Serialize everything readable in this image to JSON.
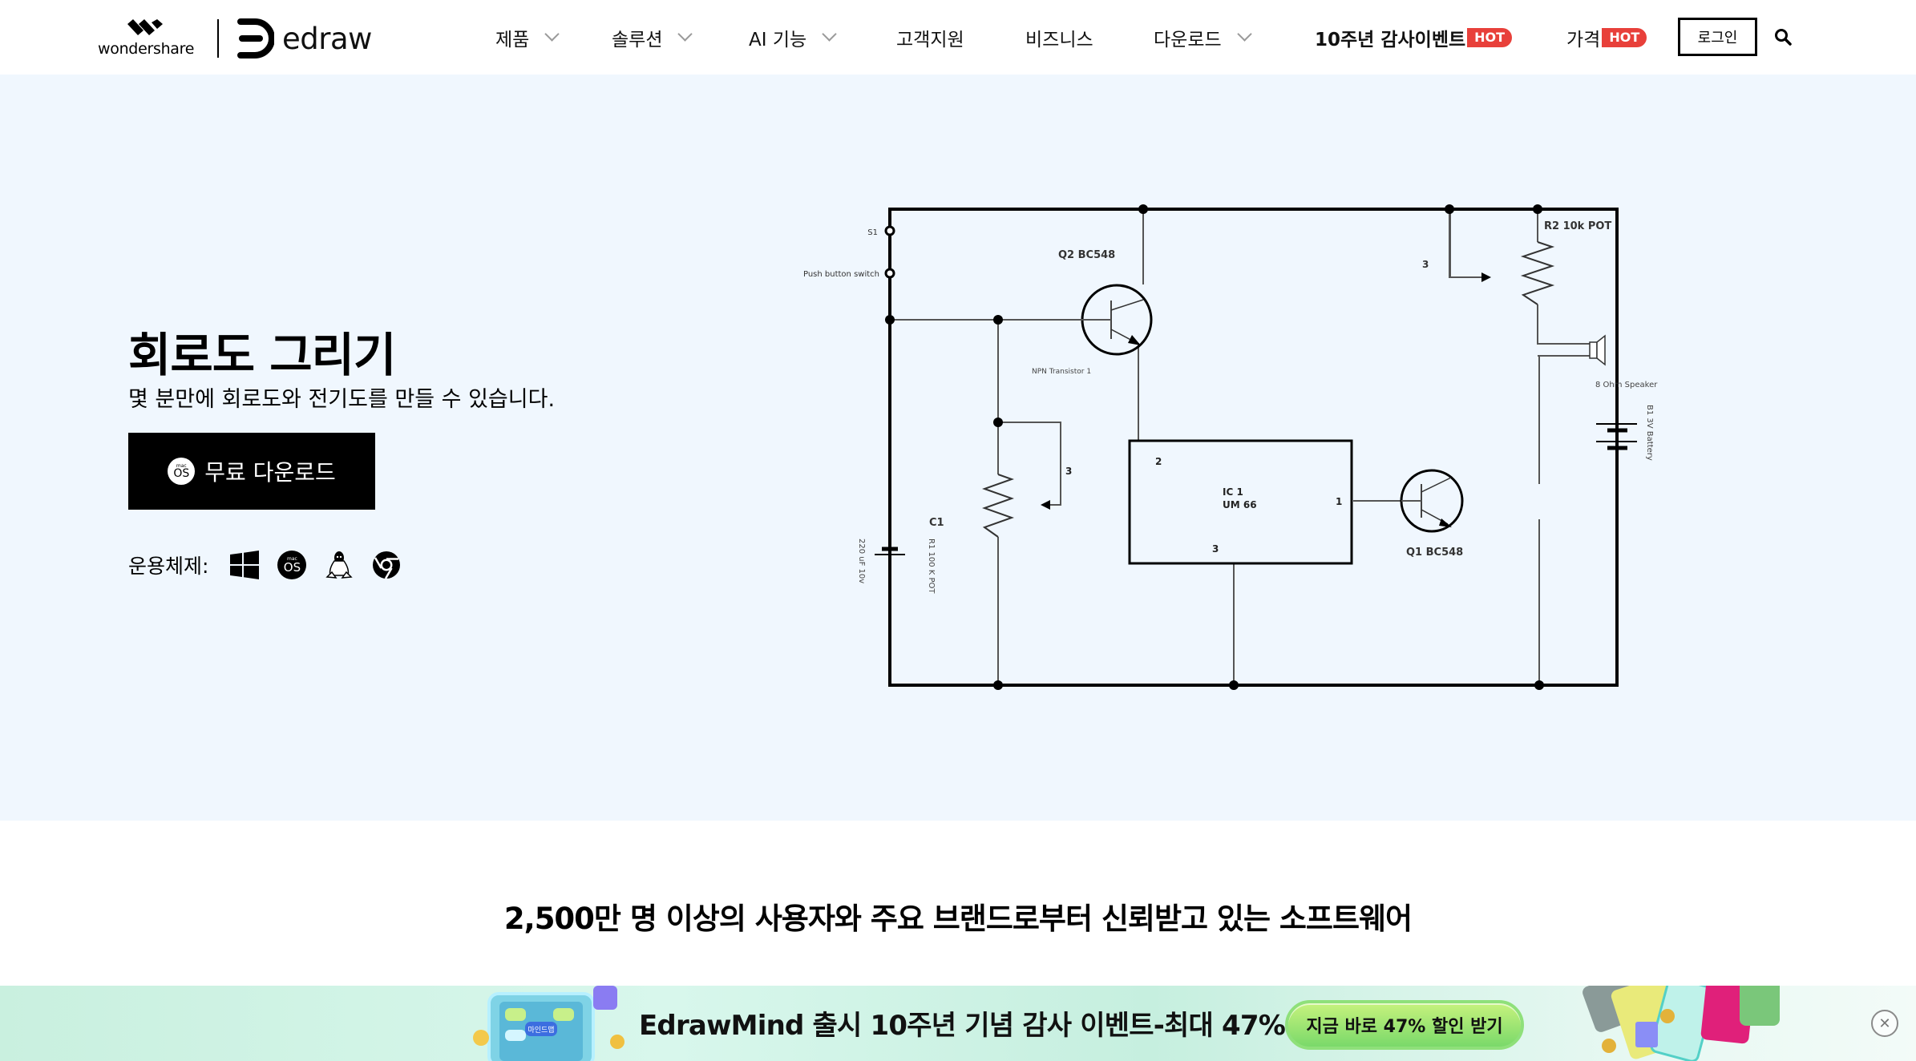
{
  "header": {
    "brand_parent": "wondershare",
    "brand_product": "edraw",
    "nav": [
      {
        "label": "제품",
        "has_dropdown": true
      },
      {
        "label": "솔루션",
        "has_dropdown": true
      },
      {
        "label": "AI 기능",
        "has_dropdown": true
      },
      {
        "label": "고객지원",
        "has_dropdown": false
      },
      {
        "label": "비즈니스",
        "has_dropdown": false
      },
      {
        "label": "다운로드",
        "has_dropdown": true
      },
      {
        "label": "10주년 감사이벤트",
        "badge": "HOT",
        "bold": true
      },
      {
        "label": "가격",
        "badge": "HOT"
      }
    ],
    "login_label": "로그인",
    "search_icon": "search-icon"
  },
  "hero": {
    "title": "회로도 그리기",
    "subtitle": "몇 분만에 회로도와 전기도를 만들 수 있습니다.",
    "download_button": {
      "label": "무료 다운로드",
      "badge_top": "mac",
      "badge_main": "OS"
    },
    "os_label": "운용체제:",
    "os_icons": [
      "windows-icon",
      "macos-icon",
      "linux-icon",
      "chrome-icon"
    ]
  },
  "circuit": {
    "labels": {
      "s1": "S1",
      "push_button": "Push button switch",
      "q2": "Q2 BC548",
      "npn": "NPN Transistor 1",
      "r2": "R2 10k POT",
      "pin3_top": "3",
      "speaker": "8 Ohm Speaker",
      "battery": "B1 3V Battery",
      "ic_pin2": "2",
      "ic_name": "IC 1",
      "ic_model": "UM 66",
      "ic_pin1": "1",
      "ic_pin3": "3",
      "q1": "Q1 BC548",
      "c1": "C1",
      "r1": "R1 100 K POT",
      "cap": "220 uF 10v",
      "pin3_left": "3"
    }
  },
  "trust": {
    "text": "2,500만 명 이상의 사용자와 주요 브랜드로부터 신뢰받고 있는 소프트웨어"
  },
  "promo": {
    "text": "EdrawMind 출시 10주년 기념 감사 이벤트-최대 47% 할인",
    "cta": "지금 바로 47% 할인 받기",
    "art_label": "마인드맵",
    "close": "✕"
  },
  "colors": {
    "hero_bg": "#f0f7fe",
    "hot_badge": "#e8403a",
    "cta_green": "#7ad96a"
  }
}
